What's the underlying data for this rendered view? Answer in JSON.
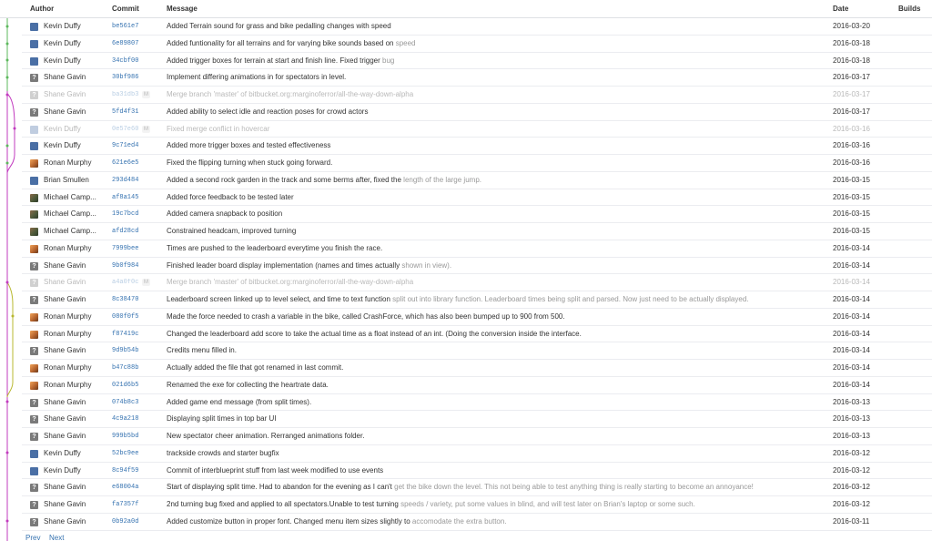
{
  "columns": {
    "author": "Author",
    "commit": "Commit",
    "message": "Message",
    "date": "Date",
    "builds": "Builds"
  },
  "colors": {
    "link": "#3572b0",
    "graph_green": "#5cb85c",
    "graph_magenta": "#c23bbf",
    "graph_olive": "#b8b830",
    "faded": "#999999"
  },
  "commits": [
    {
      "author": "Kevin Duffy",
      "avatar": "blue",
      "hash": "be561e7",
      "message": "Added Terrain sound for grass and bike pedalling changes with speed",
      "message_faded": "",
      "date": "2016-03-20"
    },
    {
      "author": "Kevin Duffy",
      "avatar": "blue",
      "hash": "6e89807",
      "message": "Added funtionality for all terrains and for varying bike sounds based on",
      "message_faded": " speed",
      "date": "2016-03-18"
    },
    {
      "author": "Kevin Duffy",
      "avatar": "blue",
      "hash": "34cbf00",
      "message": "Added trigger boxes for terrain at start and finish line. Fixed trigger",
      "message_faded": " bug",
      "date": "2016-03-18"
    },
    {
      "author": "Shane Gavin",
      "avatar": "gray",
      "hash": "30bf986",
      "message": "Implement differing animations in for spectators in level.",
      "message_faded": "",
      "date": "2016-03-17"
    },
    {
      "author": "Shane Gavin",
      "avatar": "gray",
      "hash": "ba31db3",
      "merged": true,
      "tag": "M",
      "message": "Merge branch 'master' of bitbucket.org:marginoferror/all-the-way-down-alpha",
      "message_faded": "",
      "date": "2016-03-17"
    },
    {
      "author": "Shane Gavin",
      "avatar": "gray",
      "hash": "5fd4f31",
      "message": "Added ability to select idle and reaction poses for crowd actors",
      "message_faded": "",
      "date": "2016-03-17"
    },
    {
      "author": "Kevin Duffy",
      "avatar": "blue",
      "hash": "0e57e60",
      "merged": true,
      "tag": "M",
      "message": "Fixed merge conflict in hovercar",
      "message_faded": "",
      "date": "2016-03-16"
    },
    {
      "author": "Kevin Duffy",
      "avatar": "blue",
      "hash": "9c71ed4",
      "message": "Added more trigger boxes and tested effectiveness",
      "message_faded": "",
      "date": "2016-03-16"
    },
    {
      "author": "Ronan Murphy",
      "avatar": "photo",
      "hash": "621e6e5",
      "message": "Fixed the flipping turning when stuck going forward.",
      "message_faded": "",
      "date": "2016-03-16"
    },
    {
      "author": "Brian Smullen",
      "avatar": "blue",
      "hash": "293d484",
      "message": "Added a second rock garden in the track and some berms after, fixed the",
      "message_faded": " length of the large jump.",
      "date": "2016-03-15"
    },
    {
      "author": "Michael Camp...",
      "avatar": "photo2",
      "hash": "af8a145",
      "message": "Added force feedback to be tested later",
      "message_faded": "",
      "date": "2016-03-15"
    },
    {
      "author": "Michael Camp...",
      "avatar": "photo2",
      "hash": "19c7bcd",
      "message": "Added camera snapback to position",
      "message_faded": "",
      "date": "2016-03-15"
    },
    {
      "author": "Michael Camp...",
      "avatar": "photo2",
      "hash": "afd28cd",
      "message": "Constrained headcam, improved turning",
      "message_faded": "",
      "date": "2016-03-15"
    },
    {
      "author": "Ronan Murphy",
      "avatar": "photo",
      "hash": "7999bee",
      "message": "Times are pushed to the leaderboard everytime you finish the race.",
      "message_faded": "",
      "date": "2016-03-14"
    },
    {
      "author": "Shane Gavin",
      "avatar": "gray",
      "hash": "9b0f984",
      "message": "Finished leader board display implementation (names and times actually",
      "message_faded": " shown in view).",
      "date": "2016-03-14"
    },
    {
      "author": "Shane Gavin",
      "avatar": "gray",
      "hash": "a4a0f0c",
      "merged": true,
      "tag": "M",
      "message": "Merge branch 'master' of bitbucket.org:marginoferror/all-the-way-down-alpha",
      "message_faded": "",
      "date": "2016-03-14"
    },
    {
      "author": "Shane Gavin",
      "avatar": "gray",
      "hash": "8c38470",
      "message": "Leaderboard screen linked up to level select, and time to text function",
      "message_faded": " split out into library function. Leaderboard times being split and parsed. Now just need to be actually displayed.",
      "date": "2016-03-14"
    },
    {
      "author": "Ronan Murphy",
      "avatar": "photo",
      "hash": "080f0f5",
      "message": "Made the force needed to crash a variable in the bike, called CrashForce, which has also been bumped up to 900 from 500.",
      "message_faded": "",
      "date": "2016-03-14"
    },
    {
      "author": "Ronan Murphy",
      "avatar": "photo",
      "hash": "f87419c",
      "message": "Changed the leaderboard add score to take the actual time as a float instead of an int. (Doing the conversion inside the interface.",
      "message_faded": "",
      "date": "2016-03-14"
    },
    {
      "author": "Shane Gavin",
      "avatar": "gray",
      "hash": "9d9b54b",
      "message": "Credits menu filled in.",
      "message_faded": "",
      "date": "2016-03-14"
    },
    {
      "author": "Ronan Murphy",
      "avatar": "photo",
      "hash": "b47c88b",
      "message": "Actually added the file that got renamed in last commit.",
      "message_faded": "",
      "date": "2016-03-14"
    },
    {
      "author": "Ronan Murphy",
      "avatar": "photo",
      "hash": "021d6b5",
      "message": "Renamed the exe for collecting the heartrate data.",
      "message_faded": "",
      "date": "2016-03-14"
    },
    {
      "author": "Shane Gavin",
      "avatar": "gray",
      "hash": "074b8c3",
      "message": "Added game end message (from split times).",
      "message_faded": "",
      "date": "2016-03-13"
    },
    {
      "author": "Shane Gavin",
      "avatar": "gray",
      "hash": "4c9a218",
      "message": "Displaying split times in top bar UI",
      "message_faded": "",
      "date": "2016-03-13"
    },
    {
      "author": "Shane Gavin",
      "avatar": "gray",
      "hash": "999b5bd",
      "message": "New spectator cheer animation. Rerranged animations folder.",
      "message_faded": "",
      "date": "2016-03-13"
    },
    {
      "author": "Kevin Duffy",
      "avatar": "blue",
      "hash": "52bc9ee",
      "message": "trackside crowds and starter bugfix",
      "message_faded": "",
      "date": "2016-03-12"
    },
    {
      "author": "Kevin Duffy",
      "avatar": "blue",
      "hash": "8c94f59",
      "message": "Commit of interblueprint stuff from last week modified to use events",
      "message_faded": "",
      "date": "2016-03-12"
    },
    {
      "author": "Shane Gavin",
      "avatar": "gray",
      "hash": "e68004a",
      "message": "Start of displaying split time. Had to abandon for the evening as I can't",
      "message_faded": " get the bike down the level. This not being able to test anything thing is really starting to become an annoyance!",
      "date": "2016-03-12"
    },
    {
      "author": "Shane Gavin",
      "avatar": "gray",
      "hash": "fa7357f",
      "message": "2nd turning bug fixed and applied to all spectators.Unable to test turning",
      "message_faded": " speeds / variety, put some values in blind, and will test later on Brian's laptop or some such.",
      "date": "2016-03-12"
    },
    {
      "author": "Shane Gavin",
      "avatar": "gray",
      "hash": "0b92a0d",
      "message": "Added customize button in proper font. Changed menu item sizes slightly to",
      "message_faded": " accomodate the extra button.",
      "date": "2016-03-11"
    }
  ],
  "pager": {
    "prev": "Prev",
    "next": "Next"
  }
}
